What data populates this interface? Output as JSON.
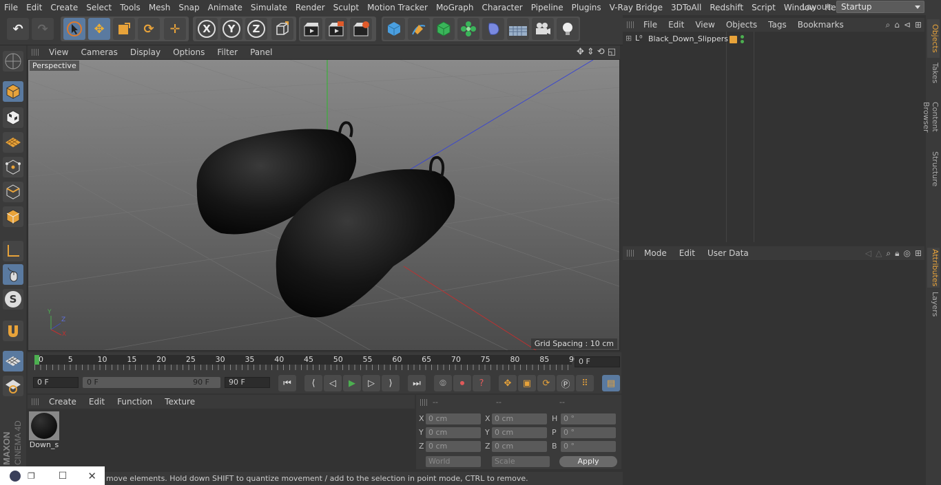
{
  "menubar": {
    "items": [
      "File",
      "Edit",
      "Create",
      "Select",
      "Tools",
      "Mesh",
      "Snap",
      "Animate",
      "Simulate",
      "Render",
      "Sculpt",
      "Motion Tracker",
      "MoGraph",
      "Character",
      "Pipeline",
      "Plugins",
      "V-Ray Bridge",
      "3DToAll",
      "Redshift",
      "Script",
      "Window",
      "Help"
    ],
    "layout_label": "Layout:",
    "layout_value": "Startup"
  },
  "toolbar": {
    "x_label": "X",
    "y_label": "Y",
    "z_label": "Z"
  },
  "viewport": {
    "menu": [
      "View",
      "Cameras",
      "Display",
      "Options",
      "Filter",
      "Panel"
    ],
    "camera_label": "Perspective",
    "grid_spacing": "Grid Spacing : 10 cm",
    "axis_x": "X",
    "axis_y": "Y",
    "axis_z": "Z"
  },
  "timeline": {
    "ticks": [
      "0",
      "5",
      "10",
      "15",
      "20",
      "25",
      "30",
      "35",
      "40",
      "45",
      "50",
      "55",
      "60",
      "65",
      "70",
      "75",
      "80",
      "85",
      "90"
    ],
    "current_frame": "0 F"
  },
  "transport": {
    "start_field": "0 F",
    "range_start": "0 F",
    "range_end": "90 F",
    "end_field": "90 F"
  },
  "material_manager": {
    "menu": [
      "Create",
      "Edit",
      "Function",
      "Texture"
    ],
    "materials": [
      {
        "name": "Down_s"
      }
    ]
  },
  "coordinates": {
    "headers": [
      "--",
      "--",
      "--"
    ],
    "rows": [
      {
        "pos_label": "X",
        "pos": "0 cm",
        "size_label": "X",
        "size": "0 cm",
        "rot_label": "H",
        "rot": "0 °"
      },
      {
        "pos_label": "Y",
        "pos": "0 cm",
        "size_label": "Y",
        "size": "0 cm",
        "rot_label": "P",
        "rot": "0 °"
      },
      {
        "pos_label": "Z",
        "pos": "0 cm",
        "size_label": "Z",
        "size": "0 cm",
        "rot_label": "B",
        "rot": "0 °"
      }
    ],
    "world": "World",
    "scale": "Scale",
    "apply": "Apply"
  },
  "object_manager": {
    "menu": [
      "File",
      "Edit",
      "View",
      "Objects",
      "Tags",
      "Bookmarks"
    ],
    "objects": [
      {
        "name": "Black_Down_Slippers"
      }
    ]
  },
  "attribute_manager": {
    "menu": [
      "Mode",
      "Edit",
      "User Data"
    ]
  },
  "right_tabs": [
    "Objects",
    "Takes",
    "Content Browser",
    "Structure",
    "Attributes",
    "Layers"
  ],
  "brand": {
    "maxon": "MAXON",
    "product": "CINEMA 4D"
  },
  "status": "move elements. Hold down SHIFT to quantize movement / add to the selection in point mode, CTRL to remove.",
  "colors": {
    "accent": "#5a7aa0",
    "orange": "#e8a33a",
    "green_axis": "#4caf50",
    "red_axis": "#c0392b",
    "blue_axis": "#4050c0"
  }
}
